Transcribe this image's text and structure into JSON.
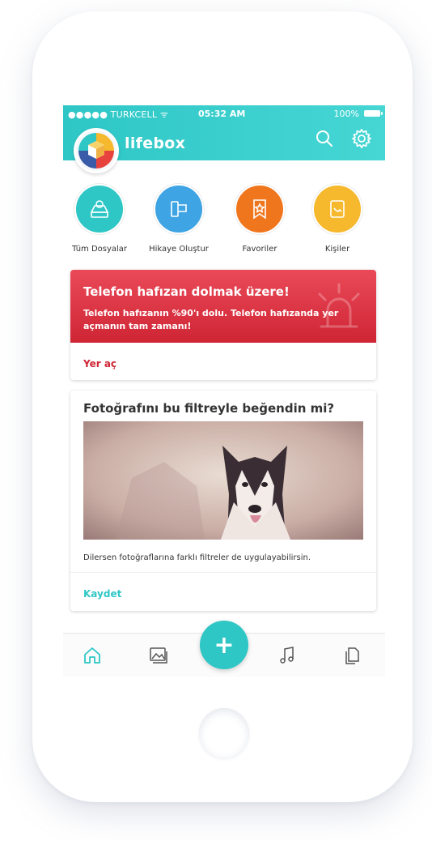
{
  "status": {
    "carrier": "●●●●● TURKCELL ᯤ",
    "time": "05:32 AM",
    "battery": "100%"
  },
  "app": {
    "name": "lifebox"
  },
  "quick_actions": [
    {
      "label": "Tüm Dosyalar",
      "color": "#2ec7c6",
      "icon": "drive-icon"
    },
    {
      "label": "Hikaye Oluştur",
      "color": "#3fa4e3",
      "icon": "film-icon"
    },
    {
      "label": "Favoriler",
      "color": "#f0761e",
      "icon": "star-icon"
    },
    {
      "label": "Kişiler",
      "color": "#f6b82c",
      "icon": "contacts-icon"
    }
  ],
  "alert": {
    "title": "Telefon hafızan dolmak üzere!",
    "body": "Telefon hafızanın %90'ı dolu. Telefon hafızanda yer açmanın tam zamanı!",
    "action": "Yer aç",
    "color": "#cf2535"
  },
  "filter_card": {
    "title": "Fotoğrafını bu filtreyle beğendin mi?",
    "text": "Dilersen fotoğraflarına farklı filtreler de uygulayabilirsin.",
    "action": "Kaydet"
  },
  "tabs": [
    "home-icon",
    "photos-icon",
    "music-icon",
    "documents-icon"
  ],
  "fab": {
    "label": "+"
  },
  "accent": "#2ec7c6"
}
